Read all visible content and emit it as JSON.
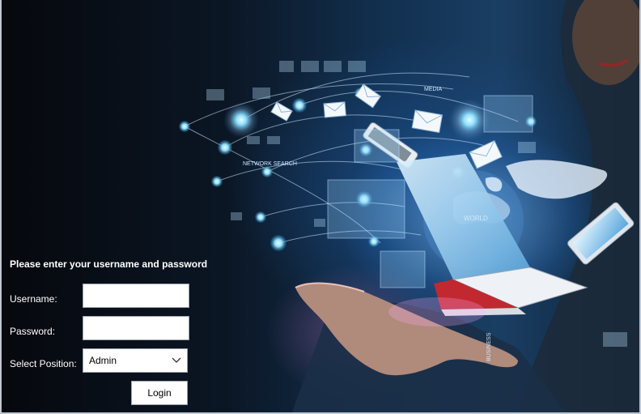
{
  "form": {
    "heading": "Please enter your username and password",
    "username_label": "Username:",
    "username_value": "",
    "password_label": "Password:",
    "password_value": "",
    "position_label": "Select Position:",
    "position_value": "Admin",
    "login_label": "Login"
  },
  "background": {
    "icon": "technology-network-hand-laptop-illustration",
    "texts": [
      "MEDIA",
      "NETWORK SEARCH",
      "WORLD",
      "BUSINESS"
    ]
  }
}
